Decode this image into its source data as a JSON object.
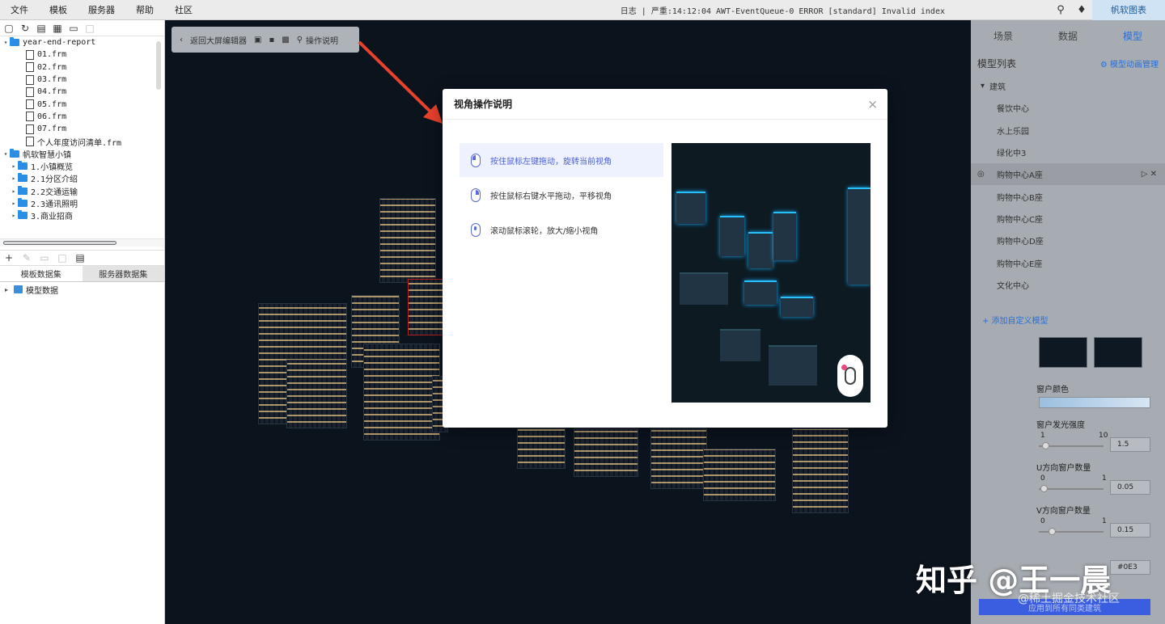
{
  "menubar": {
    "items": [
      "文件",
      "模板",
      "服务器",
      "帮助",
      "社区"
    ],
    "log_text": "日志 | 严重:14:12:04 AWT-EventQueue-0 ERROR [standard] Invalid index",
    "brand_label": "帆软图表"
  },
  "left_panel": {
    "tree": [
      {
        "label": "year-end-report",
        "type": "folder",
        "expanded": true,
        "indent": 0
      },
      {
        "label": "01.frm",
        "type": "file",
        "indent": 2
      },
      {
        "label": "02.frm",
        "type": "file",
        "indent": 2
      },
      {
        "label": "03.frm",
        "type": "file",
        "indent": 2
      },
      {
        "label": "04.frm",
        "type": "file",
        "indent": 2
      },
      {
        "label": "05.frm",
        "type": "file",
        "indent": 2
      },
      {
        "label": "06.frm",
        "type": "file",
        "indent": 2
      },
      {
        "label": "07.frm",
        "type": "file",
        "indent": 2
      },
      {
        "label": "个人年度访问清单.frm",
        "type": "file",
        "indent": 2
      },
      {
        "label": "帆软智慧小镇",
        "type": "folder",
        "expanded": true,
        "indent": 0
      },
      {
        "label": "1.小镇概览",
        "type": "folder",
        "expanded": false,
        "indent": 1
      },
      {
        "label": "2.1分区介绍",
        "type": "folder",
        "expanded": false,
        "indent": 1
      },
      {
        "label": "2.2交通运输",
        "type": "folder",
        "expanded": false,
        "indent": 1
      },
      {
        "label": "2.3通讯照明",
        "type": "folder",
        "expanded": false,
        "indent": 1
      },
      {
        "label": "3.商业招商",
        "type": "folder",
        "expanded": false,
        "indent": 1
      }
    ],
    "dataset_tabs": [
      "模板数据集",
      "服务器数据集"
    ],
    "dataset_item": "模型数据"
  },
  "editor": {
    "back_label": "返回大屏编辑器",
    "help_label": "操作说明"
  },
  "dialog": {
    "title": "视角操作说明",
    "close_glyph": "×",
    "ops": [
      {
        "label": "按住鼠标左键拖动，旋转当前视角",
        "button": "left",
        "active": true
      },
      {
        "label": "按住鼠标右键水平拖动，平移视角",
        "button": "right",
        "active": false
      },
      {
        "label": "滚动鼠标滚轮，放大/缩小视角",
        "button": "wheel",
        "active": false
      }
    ]
  },
  "right_panel": {
    "tabs": [
      "场景",
      "数据",
      "模型"
    ],
    "active_tab": 2,
    "section_title": "模型列表",
    "anim_link": "模型动画管理",
    "models": [
      {
        "label": "建筑",
        "group": true
      },
      {
        "label": "餐饮中心"
      },
      {
        "label": "水上乐园"
      },
      {
        "label": "绿化中3"
      },
      {
        "label": "购物中心A座",
        "selected": true
      },
      {
        "label": "购物中心B座"
      },
      {
        "label": "购物中心C座"
      },
      {
        "label": "购物中心D座"
      },
      {
        "label": "购物中心E座"
      },
      {
        "label": "文化中心"
      }
    ],
    "add_model": "+ 添加自定义模型",
    "props": {
      "window_color_label": "窗户颜色",
      "glow_label": "窗户发光强度",
      "glow_min": "1",
      "glow_max": "10",
      "glow_value": "1.5",
      "u_label": "U方向窗户数量",
      "u_min": "0",
      "u_max": "1",
      "u_value": "0.05",
      "v_label": "V方向窗户数量",
      "v_min": "0",
      "v_max": "1",
      "v_value": "0.15",
      "color_hex": "#0E3"
    },
    "apply_label": "应用到所有同类建筑"
  },
  "watermark": {
    "main": "知乎 @王一晨",
    "sub": "@稀土掘金技术社区"
  },
  "colors": {
    "accent": "#4b5fd6",
    "link": "#2a6fd4",
    "folder": "#2a8ee6",
    "arrow": "#e8412c"
  }
}
